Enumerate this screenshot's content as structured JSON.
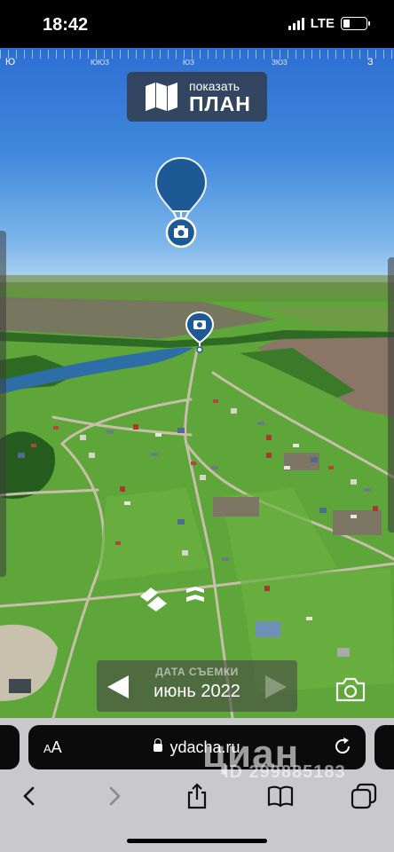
{
  "status_bar": {
    "time": "18:42",
    "network": "LTE",
    "battery_level": 0.3
  },
  "panorama": {
    "compass": {
      "labels": [
        "Ю",
        "ЮЮЗ",
        "ЮЗ",
        "ЗЮЗ",
        "З"
      ]
    },
    "show_plan_button": {
      "label_small": "показать",
      "label_big": "ПЛАН"
    },
    "date_panel": {
      "label": "ДАТА СЪЕМКИ",
      "value": "июнь 2022"
    },
    "icons": [
      "map-icon",
      "balloon-camera-icon",
      "camera-location-icon",
      "forward-arrows-icon",
      "camera-icon"
    ]
  },
  "browser": {
    "text_size_label_small": "A",
    "text_size_label_big": "A",
    "url": "ydacha.ru",
    "watermark": "циан",
    "watermark_id": "ID 299885183",
    "toolbar_icons": [
      "back-icon",
      "forward-icon",
      "share-icon",
      "bookmarks-icon",
      "tabs-icon"
    ]
  },
  "colors": {
    "sky_top": "#2d6fd2",
    "grass": "#5fa83a",
    "balloon": "#1e5a96",
    "plan_button_bg": "#323c4b"
  }
}
